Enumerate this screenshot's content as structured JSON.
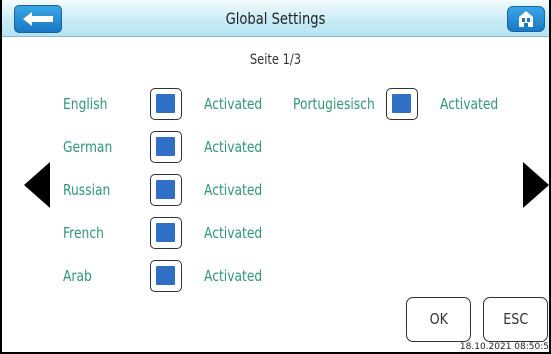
{
  "header": {
    "title": "Global Settings"
  },
  "page": {
    "label": "Seite 1/3"
  },
  "languages": [
    {
      "name": "English",
      "status": "Activated",
      "checked": true
    },
    {
      "name": "German",
      "status": "Activated",
      "checked": true
    },
    {
      "name": "Russian",
      "status": "Activated",
      "checked": true
    },
    {
      "name": "French",
      "status": "Activated",
      "checked": true
    },
    {
      "name": "Arab",
      "status": "Activated",
      "checked": true
    },
    {
      "name": "Portugiesisch",
      "status": "Activated",
      "checked": true
    }
  ],
  "buttons": {
    "ok": "OK",
    "esc": "ESC"
  },
  "footer": {
    "timestamp": "18.10.2021 08:50:5"
  },
  "colors": {
    "label": "#2c9a78",
    "checkbox_fill": "#2f6fc6",
    "titlebar": "#c9ecf6",
    "accent_button": "#1a77c4"
  },
  "icons": {
    "back": "back-arrow-icon",
    "home": "home-icon",
    "prev": "triangle-left-icon",
    "next": "triangle-right-icon"
  }
}
